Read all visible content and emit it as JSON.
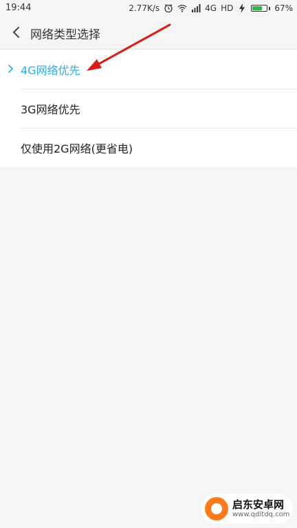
{
  "status_bar": {
    "time": "19:44",
    "net_speed": "2.77K/s",
    "network": "4G",
    "hd": "HD",
    "battery": "67%",
    "battery_level": 0.67,
    "battery_color": "#33b54a",
    "icons": [
      "alarm-icon",
      "wifi-icon",
      "signal-icon",
      "charging-icon"
    ]
  },
  "header": {
    "title": "网络类型选择",
    "back_icon": "chevron-left-icon"
  },
  "options": [
    {
      "label": "4G网络优先",
      "selected": true
    },
    {
      "label": "3G网络优先",
      "selected": false
    },
    {
      "label": "仅使用2G网络(更省电)",
      "selected": false
    }
  ],
  "accent_color": "#2eaee6",
  "annotation_color": "#d91e18",
  "watermark": {
    "title": "启东安卓网",
    "subtitle": "www.qdltdq.com"
  }
}
